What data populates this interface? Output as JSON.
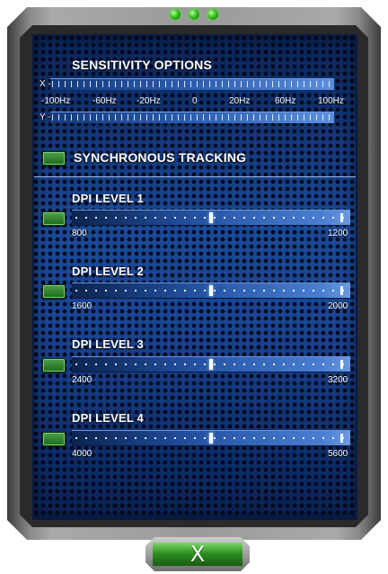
{
  "sensitivity": {
    "title": "SENSITIVITY OPTIONS",
    "x_axis_label": "X -",
    "y_axis_label": "Y -",
    "scale_ticks": [
      "-100Hz",
      "-60Hz",
      "-20Hz",
      "0",
      "20Hz",
      "60Hz",
      "100Hz"
    ]
  },
  "sync_tracking": {
    "label": "SYNCHRONOUS TRACKING",
    "checked": true
  },
  "dpi_levels": [
    {
      "label": "DPI LEVEL  1",
      "min": "800",
      "max": "1200",
      "value_fraction": 0.5
    },
    {
      "label": "DPI LEVEL  2",
      "min": "1600",
      "max": "2000",
      "value_fraction": 0.5
    },
    {
      "label": "DPI LEVEL  3",
      "min": "2400",
      "max": "3200",
      "value_fraction": 0.5
    },
    {
      "label": "DPI LEVEL  4",
      "min": "4000",
      "max": "5600",
      "value_fraction": 0.5
    }
  ],
  "close_button": {
    "label": "X"
  },
  "colors": {
    "panel": "#1b4a97",
    "led": "#39c11d",
    "button": "#2b8a1d"
  }
}
